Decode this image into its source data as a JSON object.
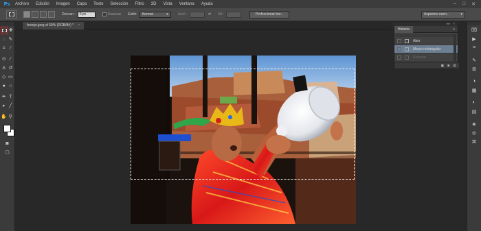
{
  "app": {
    "logo": "Ps",
    "menu": [
      "Archivo",
      "Edición",
      "Imagen",
      "Capa",
      "Texto",
      "Selección",
      "Filtro",
      "3D",
      "Vista",
      "Ventana",
      "Ayuda"
    ],
    "window_buttons": [
      "–",
      "□",
      "✕"
    ]
  },
  "options": {
    "feather_label": "Desvan.:",
    "feather_value": "0 px",
    "antialias_label": "Suavizar",
    "style_label": "Estilo:",
    "style_value": "Normal",
    "width_label": "Anch.:",
    "height_label": "Alt.:",
    "refine_button": "Perfeccionar bor...",
    "workspace_value": "Aspectos esen..."
  },
  "document": {
    "tab_title": "festejo.jpeg al 50% (RGB/8#) *",
    "close": "×"
  },
  "history": {
    "tab_label": "Historia",
    "menu_glyph": "≡",
    "collapse_glyph": "▸▸",
    "close_glyph": "×",
    "items": [
      {
        "label": "Abrir",
        "state": "normal"
      },
      {
        "label": "Marco rectangular",
        "state": "selected"
      },
      {
        "label": "Recortar",
        "state": "ghost"
      }
    ]
  },
  "colors": {
    "accent_highlight": "#6d7f93",
    "tool_highlight_border": "#d42020",
    "ps_blue": "#31a8ff"
  }
}
